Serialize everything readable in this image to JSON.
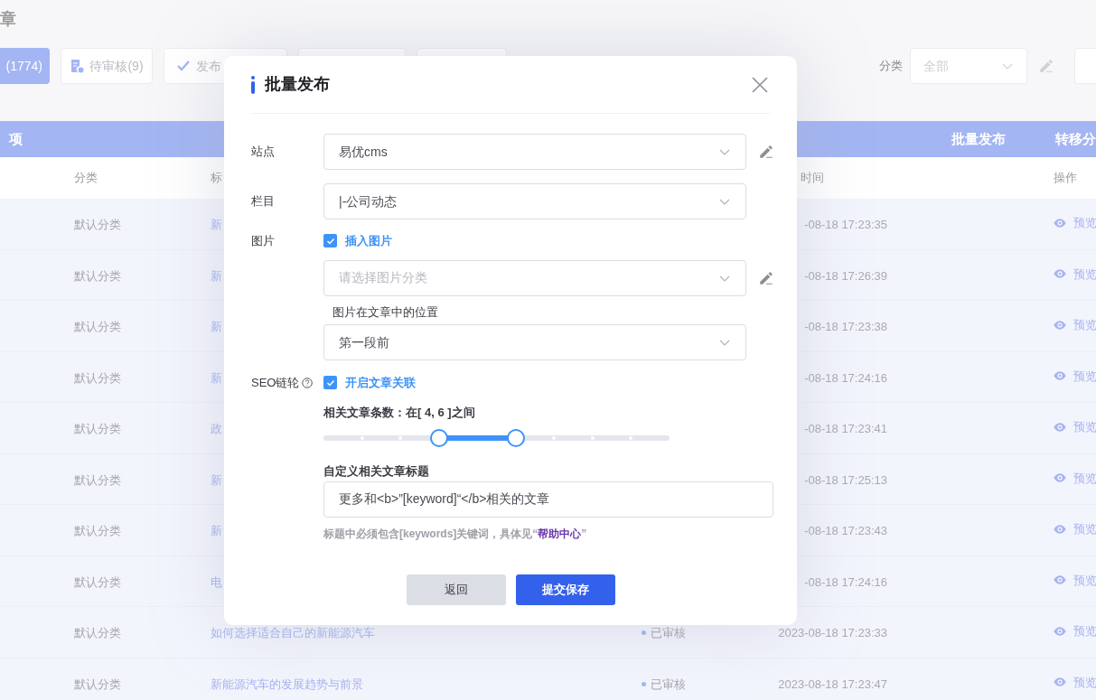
{
  "page": {
    "title": "章"
  },
  "tabs": [
    {
      "label": "(1774)",
      "selected": true
    },
    {
      "label": "待审核(9)",
      "selected": false
    },
    {
      "label": "发布",
      "selected": false
    },
    {
      "selected": false
    },
    {
      "selected": false
    }
  ],
  "filter": {
    "label": "分类",
    "placeholder": "全部"
  },
  "bulk_bar": {
    "count": "项",
    "actions": [
      "批量发布",
      "转移分"
    ]
  },
  "table": {
    "columns": [
      "分类",
      "标",
      "时间",
      "操作"
    ],
    "rows": [
      {
        "category": "默认分类",
        "title": "新",
        "time": "-08-18 17:23:35",
        "action": "预览"
      },
      {
        "category": "默认分类",
        "title": "新",
        "time": "-08-18 17:26:39",
        "action": "预览"
      },
      {
        "category": "默认分类",
        "title": "新",
        "time": "-08-18 17:23:38",
        "action": "预览"
      },
      {
        "category": "默认分类",
        "title": "新",
        "time": "-08-18 17:24:16",
        "action": "预览"
      },
      {
        "category": "默认分类",
        "title": "政",
        "time": "-08-18 17:23:41",
        "action": "预览"
      },
      {
        "category": "默认分类",
        "title": "新",
        "time": "-08-18 17:25:13",
        "action": "预览"
      },
      {
        "category": "默认分类",
        "title": "新",
        "time": "-08-18 17:23:43",
        "action": "预览"
      },
      {
        "category": "默认分类",
        "title": "电",
        "time": "-08-18 17:24:16",
        "action": "预览"
      },
      {
        "category": "默认分类",
        "title": "如何选择适合自己的新能源汽车",
        "status": "已审核",
        "time": "2023-08-18 17:23:33",
        "action": "预览"
      },
      {
        "category": "默认分类",
        "title": "新能源汽车的发展趋势与前景",
        "status": "已审核",
        "time": "2023-08-18 17:23:47",
        "action": "预览"
      }
    ]
  },
  "dialog": {
    "title": "批量发布",
    "site": {
      "label": "站点",
      "value": "易优cms"
    },
    "column": {
      "label": "栏目",
      "value": "|-公司动态"
    },
    "image": {
      "label": "图片",
      "checkbox": {
        "label": "插入图片",
        "checked": true
      },
      "category": {
        "placeholder": "请选择图片分类"
      },
      "position_label": "图片在文章中的位置",
      "position": {
        "value": "第一段前"
      }
    },
    "seo": {
      "label": "SEO链轮",
      "checkbox": {
        "label": "开启文章关联",
        "checked": true
      },
      "count_label": "相关文章条数：在[ 4, 6 ]之间",
      "range": [
        {
          "level": 0.333
        },
        {
          "level": 0.556
        }
      ],
      "custom_title_label": "自定义相关文章标题",
      "custom_title": {
        "value": "更多和<b>”[keyword]“</b>相关的文章"
      },
      "hint": {
        "text": "标题中必须包含[keywords]关键词，具体见“",
        "link": "帮助中心",
        "end": "”"
      }
    },
    "buttons": [
      {
        "label": "返回",
        "kind": "secondary"
      },
      {
        "label": "提交保存",
        "kind": "primary"
      }
    ]
  }
}
